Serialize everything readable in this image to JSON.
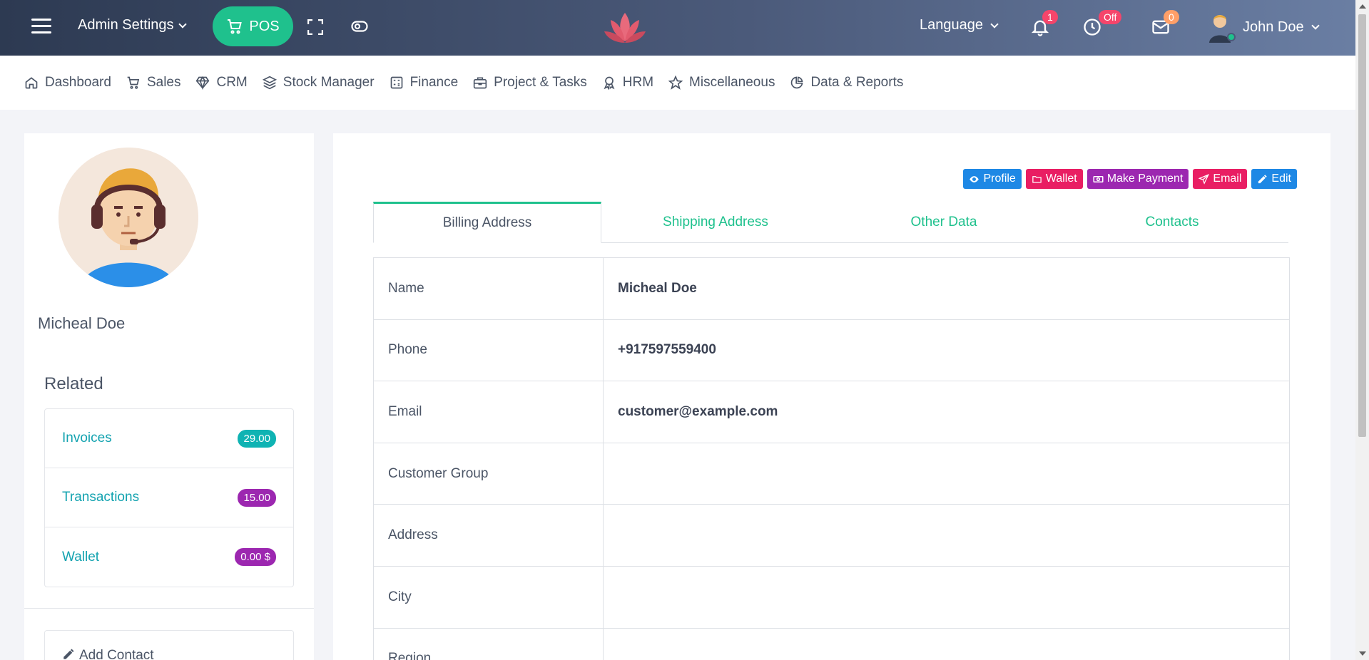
{
  "topbar": {
    "admin_settings": "Admin Settings",
    "pos_label": "POS",
    "language_label": "Language",
    "notifications_count": "1",
    "clock_status": "Off",
    "messages_count": "0",
    "user_name": "John Doe"
  },
  "nav": {
    "items": [
      {
        "label": "Dashboard",
        "icon": "home-icon"
      },
      {
        "label": "Sales",
        "icon": "cart-icon"
      },
      {
        "label": "CRM",
        "icon": "diamond-icon"
      },
      {
        "label": "Stock Manager",
        "icon": "layers-icon"
      },
      {
        "label": "Finance",
        "icon": "calculator-icon"
      },
      {
        "label": "Project & Tasks",
        "icon": "briefcase-icon"
      },
      {
        "label": "HRM",
        "icon": "award-icon"
      },
      {
        "label": "Miscellaneous",
        "icon": "star-icon"
      },
      {
        "label": "Data & Reports",
        "icon": "pie-chart-icon"
      }
    ]
  },
  "customer": {
    "name": "Micheal Doe"
  },
  "related": {
    "title": "Related",
    "items": [
      {
        "label": "Invoices",
        "value": "29.00",
        "color": "#0fb3b3"
      },
      {
        "label": "Transactions",
        "value": "15.00",
        "color": "#9c27b0"
      },
      {
        "label": "Wallet",
        "value": "0.00 $",
        "color": "#9c27b0"
      }
    ]
  },
  "add_contact": "Add Contact",
  "actions": [
    {
      "label": "Profile",
      "color": "#1e88e5",
      "icon": "eye-icon"
    },
    {
      "label": "Wallet",
      "color": "#e91e63",
      "icon": "folder-icon"
    },
    {
      "label": "Make Payment",
      "color": "#9c27b0",
      "icon": "money-icon"
    },
    {
      "label": "Email",
      "color": "#e91e63",
      "icon": "send-icon"
    },
    {
      "label": "Edit",
      "color": "#1e88e5",
      "icon": "pencil-icon"
    }
  ],
  "tabs": [
    "Billing Address",
    "Shipping Address",
    "Other Data",
    "Contacts"
  ],
  "billing": {
    "rows": [
      {
        "key": "Name",
        "value": "Micheal Doe"
      },
      {
        "key": "Phone",
        "value": "+917597559400"
      },
      {
        "key": "Email",
        "value": "customer@example.com"
      },
      {
        "key": "Customer Group",
        "value": ""
      },
      {
        "key": "Address",
        "value": ""
      },
      {
        "key": "City",
        "value": ""
      },
      {
        "key": "Region",
        "value": ""
      }
    ]
  },
  "colors": {
    "accent": "#1fc18d",
    "link": "#14a3b0",
    "badge_red": "#f5456b",
    "badge_orange": "#ff9f68"
  }
}
